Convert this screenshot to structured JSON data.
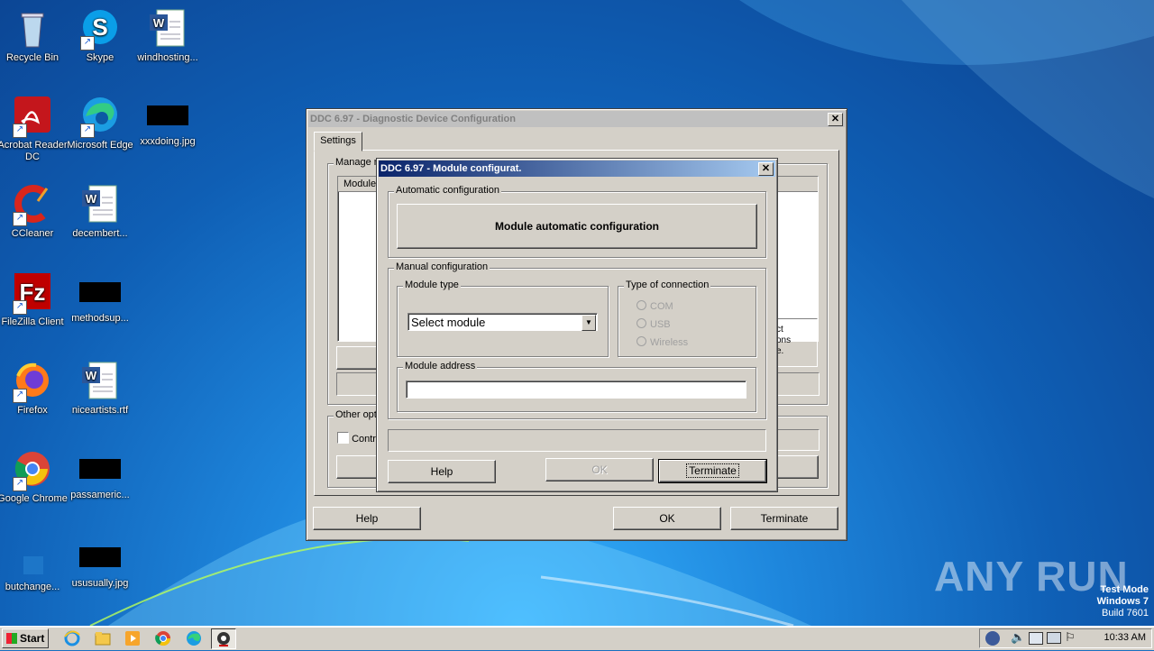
{
  "desktop": {
    "icons": [
      {
        "label": "Recycle Bin"
      },
      {
        "label": "Skype"
      },
      {
        "label": "windhosting..."
      },
      {
        "label": "Acrobat Reader DC"
      },
      {
        "label": "Microsoft Edge"
      },
      {
        "label": "xxxdoing.jpg"
      },
      {
        "label": "CCleaner"
      },
      {
        "label": "decembert..."
      },
      {
        "label": "FileZilla Client"
      },
      {
        "label": "methodsup..."
      },
      {
        "label": "Firefox"
      },
      {
        "label": "niceartists.rtf"
      },
      {
        "label": "Google Chrome"
      },
      {
        "label": "passameric..."
      },
      {
        "label": "butchange..."
      },
      {
        "label": "ususually.jpg"
      }
    ]
  },
  "main_window": {
    "title": "DDC 6.97 - Diagnostic Device Configuration",
    "tab": "Settings",
    "manage_group_label": "Manage m",
    "column_header": "Module",
    "other_options_label": "Other opti",
    "checkbox_label": "Contr",
    "partial_text": [
      "ct",
      "ons",
      "e."
    ],
    "help_label": "Help",
    "ok_label": "OK",
    "terminate_label": "Terminate"
  },
  "module_dialog": {
    "title": "DDC 6.97 - Module configurat.",
    "auto_group_label": "Automatic configuration",
    "auto_button_label": "Module automatic configuration",
    "manual_group_label": "Manual configuration",
    "module_type_label": "Module type",
    "module_select_value": "Select module",
    "connection_group_label": "Type of connection",
    "connection_options": [
      "COM",
      "USB",
      "Wireless"
    ],
    "module_address_label": "Module address",
    "module_address_value": "",
    "help_label": "Help",
    "ok_label": "OK",
    "terminate_label": "Terminate"
  },
  "taskbar": {
    "start_label": "Start",
    "clock": "10:33 AM"
  },
  "watermark": {
    "brand": "ANY RUN",
    "line1": "Test Mode",
    "line2": "Windows 7",
    "line3": "Build 7601"
  },
  "colors": {
    "active_title_start": "#0a246a",
    "active_title_end": "#a6caf0",
    "face": "#d4d0c8"
  }
}
